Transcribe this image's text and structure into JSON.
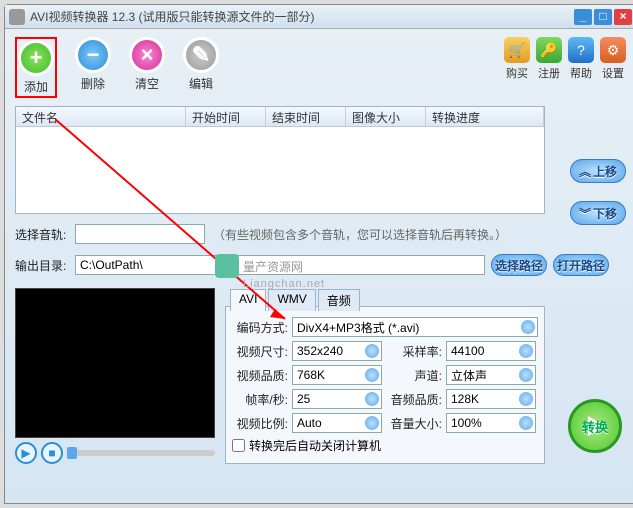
{
  "window": {
    "title": "AVI视频转换器 12.3 (试用版只能转换源文件的一部分)"
  },
  "toolbar": {
    "add": "添加",
    "del": "删除",
    "clear": "清空",
    "edit": "编辑"
  },
  "rightbar": {
    "buy": "购买",
    "reg": "注册",
    "help": "帮助",
    "set": "设置"
  },
  "list": {
    "cols": {
      "name": "文件名",
      "start": "开始时间",
      "end": "结束时间",
      "size": "图像大小",
      "prog": "转换进度"
    }
  },
  "side": {
    "up": "上移",
    "down": "下移"
  },
  "track": {
    "label": "选择音轨:",
    "hint": "（有些视频包含多个音轨，您可以选择音轨后再转换。）"
  },
  "out": {
    "label": "输出目录:",
    "value": "C:\\OutPath\\",
    "browse": "选择路径",
    "open": "打开路径"
  },
  "tabs": {
    "avi": "AVI",
    "wmv": "WMV",
    "audio": "音频"
  },
  "settings": {
    "encode_lbl": "编码方式:",
    "encode_val": "DivX4+MP3格式 (*.avi)",
    "size_lbl": "视频尺寸:",
    "size_val": "352x240",
    "rate_lbl": "采样率:",
    "rate_val": "44100",
    "vq_lbl": "视频品质:",
    "vq_val": "768K",
    "ch_lbl": "声道:",
    "ch_val": "立体声",
    "fps_lbl": "帧率/秒:",
    "fps_val": "25",
    "aq_lbl": "音频品质:",
    "aq_val": "128K",
    "ratio_lbl": "视频比例:",
    "ratio_val": "Auto",
    "vol_lbl": "音量大小:",
    "vol_val": "100%",
    "shutdown": "转换完后自动关闭计算机"
  },
  "convert": "转换",
  "watermark": {
    "main": "量产资源网",
    "sub": "Liangchan.net"
  }
}
